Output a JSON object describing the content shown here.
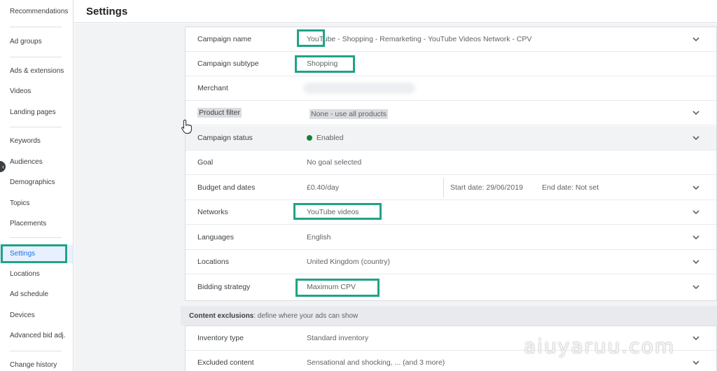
{
  "sidebar": {
    "items": [
      {
        "label": "Recommendations",
        "name": "sidebar-item-recommendations",
        "active": false
      },
      {
        "label": "Ad groups",
        "name": "sidebar-item-ad-groups",
        "active": false
      },
      {
        "label": "Ads & extensions",
        "name": "sidebar-item-ads-extensions",
        "active": false
      },
      {
        "label": "Videos",
        "name": "sidebar-item-videos",
        "active": false
      },
      {
        "label": "Landing pages",
        "name": "sidebar-item-landing-pages",
        "active": false
      },
      {
        "label": "Keywords",
        "name": "sidebar-item-keywords",
        "active": false
      },
      {
        "label": "Audiences",
        "name": "sidebar-item-audiences",
        "active": false
      },
      {
        "label": "Demographics",
        "name": "sidebar-item-demographics",
        "active": false
      },
      {
        "label": "Topics",
        "name": "sidebar-item-topics",
        "active": false
      },
      {
        "label": "Placements",
        "name": "sidebar-item-placements",
        "active": false
      },
      {
        "label": "Settings",
        "name": "sidebar-item-settings",
        "active": true
      },
      {
        "label": "Locations",
        "name": "sidebar-item-locations",
        "active": false
      },
      {
        "label": "Ad schedule",
        "name": "sidebar-item-ad-schedule",
        "active": false
      },
      {
        "label": "Devices",
        "name": "sidebar-item-devices",
        "active": false
      },
      {
        "label": "Advanced bid adj.",
        "name": "sidebar-item-advanced-bid-adj",
        "active": false
      },
      {
        "label": "Change history",
        "name": "sidebar-item-change-history",
        "active": false
      }
    ]
  },
  "header": {
    "title": "Settings"
  },
  "settings": {
    "campaign_name": {
      "label": "Campaign name",
      "value": "YouTube - Shopping - Remarketing - YouTube Videos Network - CPV"
    },
    "campaign_subtype": {
      "label": "Campaign subtype",
      "value": "Shopping"
    },
    "merchant": {
      "label": "Merchant"
    },
    "product_filter": {
      "label": "Product filter",
      "value": "None - use all products"
    },
    "campaign_status": {
      "label": "Campaign status",
      "value": "Enabled"
    },
    "goal": {
      "label": "Goal",
      "value": "No goal selected"
    },
    "budget": {
      "label": "Budget and dates",
      "value": "£0.40/day",
      "start": "Start date: 29/06/2019",
      "end": "End date: Not set"
    },
    "networks": {
      "label": "Networks",
      "value": "YouTube videos"
    },
    "languages": {
      "label": "Languages",
      "value": "English"
    },
    "locations": {
      "label": "Locations",
      "value": "United Kingdom (country)"
    },
    "bidding": {
      "label": "Bidding strategy",
      "value": "Maximum CPV"
    }
  },
  "exclusions": {
    "title": "Content exclusions",
    "subtitle": ": define where your ads can show",
    "inventory": {
      "label": "Inventory type",
      "value": "Standard inventory"
    },
    "excluded": {
      "label": "Excluded content",
      "value": "Sensational and shocking, ... (and 3 more)"
    }
  },
  "colors": {
    "accent": "#1a73e8",
    "status_green": "#188038",
    "annotation": "#20a386"
  },
  "watermark": "aiuyaruu.com"
}
